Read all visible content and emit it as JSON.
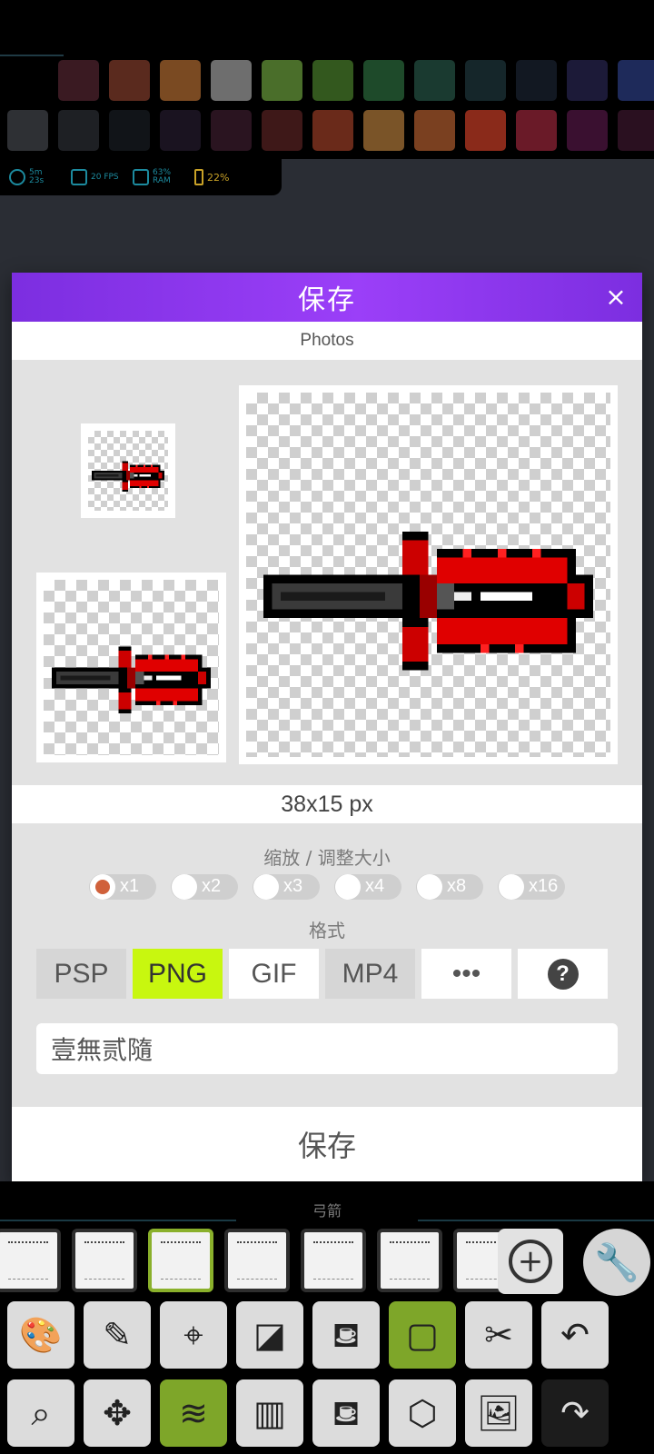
{
  "palette": {
    "row1": [
      "#3a1a22",
      "#5a2a1e",
      "#7a4a22",
      "#6e6e6e",
      "#4a6e2a",
      "#33581e",
      "#1e4a2a",
      "#1a3a30",
      "#15262a",
      "#121822",
      "#1c1a38",
      "#1e2a5a"
    ],
    "row2": [
      "#2e3034",
      "#1e2024",
      "#111418",
      "#1a1320",
      "#2a1420",
      "#3e1818",
      "#6a2a1a",
      "#7a5428",
      "#7a4020",
      "#8a2a1a",
      "#6a1a28",
      "#3a1030",
      "#2a1020"
    ]
  },
  "stats": [
    {
      "icon": "clock-icon",
      "text": "5m 23s"
    },
    {
      "icon": "chip-icon",
      "text": "20 FPS"
    },
    {
      "icon": "memory-icon",
      "text": "63% RAM"
    },
    {
      "icon": "battery-icon",
      "text": "22%"
    }
  ],
  "dialog": {
    "title": "保存",
    "close_label": "×",
    "destination": "Photos",
    "size_label": "38x15 px",
    "scale_heading": "缩放 / 调整大小",
    "scale_options": [
      "x1",
      "x2",
      "x3",
      "x4",
      "x8",
      "x16"
    ],
    "scale_selected": "x1",
    "format_heading": "格式",
    "formats": [
      "PSP",
      "PNG",
      "GIF",
      "MP4",
      "•••"
    ],
    "format_selected": "PNG",
    "help_label": "?",
    "filename": "壹無贰隨",
    "save_label": "保存"
  },
  "section_name": "弓箭",
  "colors": {
    "accent_purple": "#8a35f0",
    "format_selected": "#c8f70f",
    "scale_dot": "#d0613b",
    "tool_highlight": "#7ea629"
  }
}
